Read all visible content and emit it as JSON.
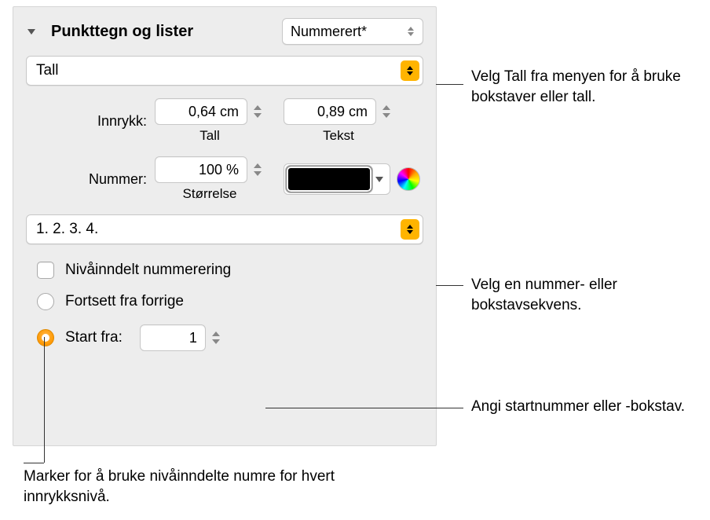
{
  "header": {
    "title": "Punkttegn og lister",
    "style_popup": "Nummerert*"
  },
  "type_popup": "Tall",
  "indent": {
    "label": "Innrykk:",
    "number_value": "0,64 cm",
    "number_sublabel": "Tall",
    "text_value": "0,89 cm",
    "text_sublabel": "Tekst"
  },
  "number": {
    "label": "Nummer:",
    "size_value": "100 %",
    "size_sublabel": "Størrelse"
  },
  "sequence_popup": "1. 2. 3. 4.",
  "tiered_label": "Nivåinndelt nummerering",
  "continue_label": "Fortsett fra forrige",
  "start_label": "Start fra:",
  "start_value": "1",
  "callouts": {
    "c1": "Velg Tall fra menyen for å bruke bokstaver eller tall.",
    "c2": "Velg en nummer- eller bokstavsekvens.",
    "c3": "Angi startnummer eller -bokstav.",
    "c4": "Marker for å bruke nivåinndelte numre for hvert innrykksnivå."
  }
}
